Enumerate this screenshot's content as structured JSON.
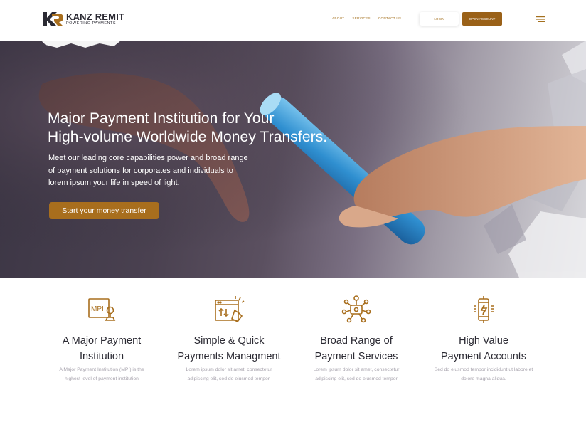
{
  "brand": {
    "name": "KANZ REMIT",
    "tagline": "POWERING PAYMENTS",
    "accent": "#9a6118"
  },
  "nav": {
    "links": [
      "ABOUT",
      "SERVICES",
      "CONTACT US"
    ],
    "login": "LOGIN",
    "open_account": "OPEN ACCOUNT",
    "menu_icon": "hamburger-icon"
  },
  "hero": {
    "title_line1": "Major Payment Institution for Your",
    "title_line2": "High-volume Worldwide Money Transfers.",
    "desc_line1": "Meet our leading core capabilities power and broad range",
    "desc_line2": "of payment solutions for corporates and individuals to",
    "desc_line3": "lorem ipsum your life in speed of light.",
    "cta": "Start your money transfer"
  },
  "features": [
    {
      "icon": "mpi-document-icon",
      "title": [
        "A Major Payment",
        "Institution"
      ],
      "desc": [
        "A Major Payment Institution (MPI) is the",
        "highest level of payment institution"
      ]
    },
    {
      "icon": "browser-transfer-icon",
      "title": [
        "Simple & Quick",
        "Payments Managment"
      ],
      "desc": [
        "Lorem ipsum dolor sit amet, consectetur",
        "adipiscing elit, sed do eiusmod tempor."
      ]
    },
    {
      "icon": "services-network-icon",
      "title": [
        "Broad Range of",
        "Payment Services"
      ],
      "desc": [
        "Lorem ipsum dolor sit amet, consectetur",
        "adipiscing elit, sed do eiusmod tempor"
      ]
    },
    {
      "icon": "mobile-payment-icon",
      "title": [
        "High Value",
        "Payment Accounts"
      ],
      "desc": [
        "Sed do eiusmod tempor incididunt ut labore et",
        "dolore magna aliqua."
      ]
    }
  ]
}
